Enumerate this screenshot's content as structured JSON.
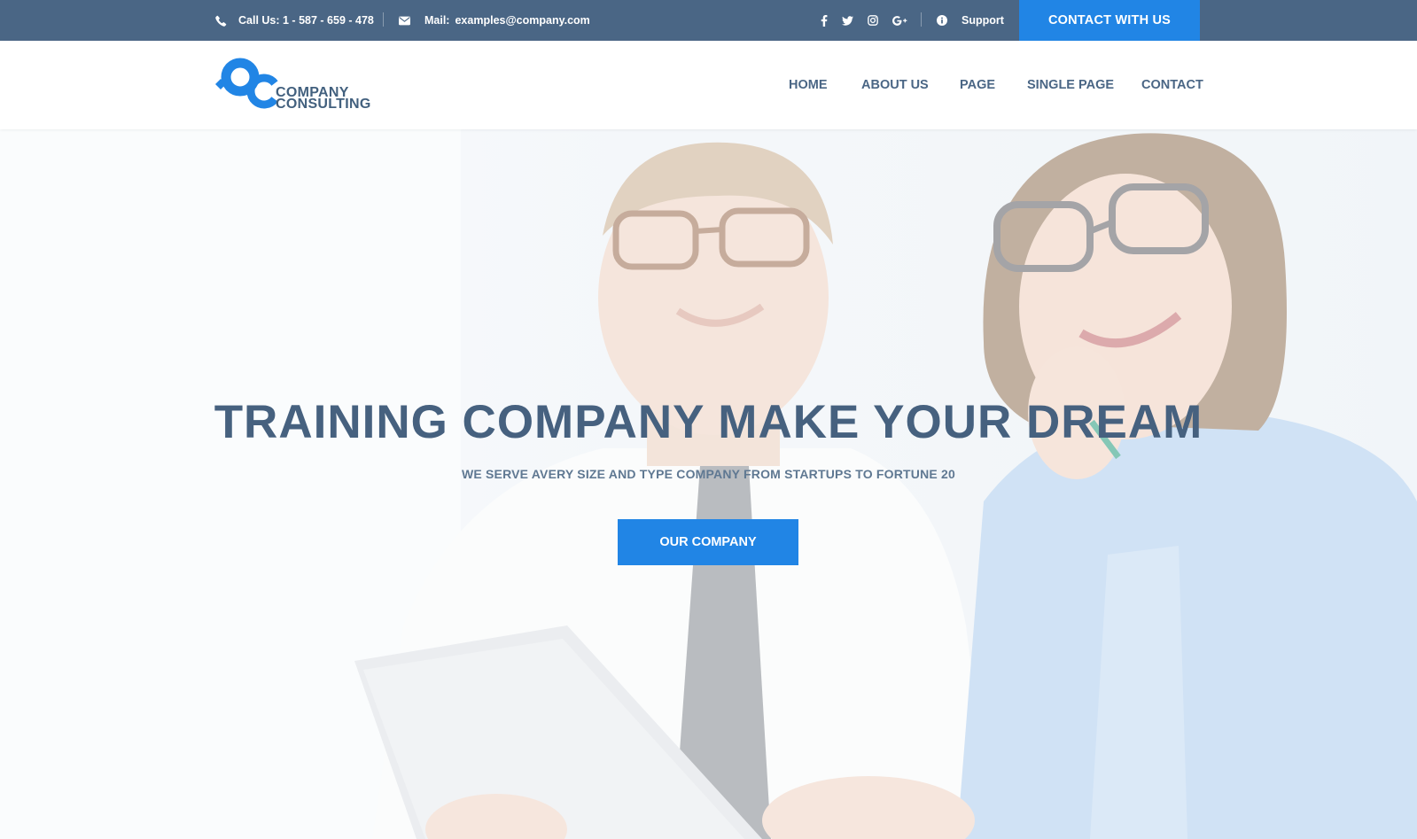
{
  "topbar": {
    "phone_icon": "phone-icon",
    "phone_text": "Call Us: 1 - 587 - 659 - 478",
    "mail_icon": "envelope-icon",
    "mail_label": "Mail:",
    "mail_value": "examples@company.com",
    "social": [
      {
        "icon": "facebook-icon",
        "glyph": "f"
      },
      {
        "icon": "twitter-icon",
        "glyph": "t"
      },
      {
        "icon": "instagram-icon",
        "glyph": "ig"
      },
      {
        "icon": "google-plus-icon",
        "glyph": "G+"
      }
    ],
    "support_icon": "info-icon",
    "support_label": "Support",
    "cta_label": "CONTACT WITH US"
  },
  "header": {
    "logo_line1": "COMPANY",
    "logo_line2": "CONSULTING",
    "nav": [
      "HOME",
      "ABOUT US",
      "PAGE",
      "SINGLE PAGE",
      "CONTACT"
    ]
  },
  "hero": {
    "title": "TRAINING COMPANY MAKE YOUR DREAM",
    "subtitle": "WE SERVE AVERY SIZE AND TYPE COMPANY FROM STARTUPS TO FORTUNE 20",
    "button_label": "OUR COMPANY"
  },
  "colors": {
    "topbar_bg": "#4a6685",
    "accent": "#2185e5",
    "nav_text": "#4a6685",
    "hero_title": "#46617f",
    "white": "#ffffff"
  }
}
